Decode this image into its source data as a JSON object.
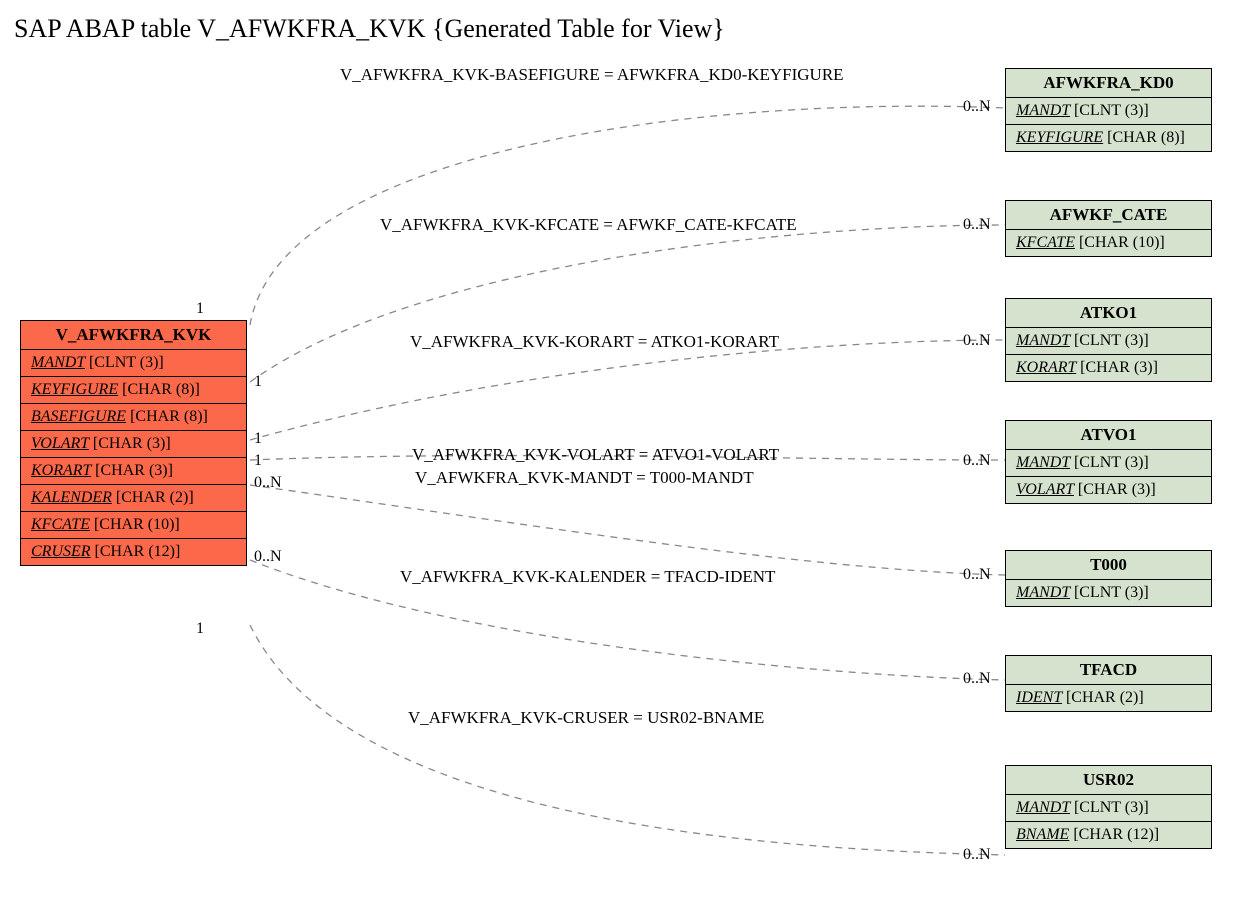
{
  "title": "SAP ABAP table V_AFWKFRA_KVK {Generated Table for View}",
  "main_entity": {
    "name": "V_AFWKFRA_KVK",
    "fields": [
      {
        "name": "MANDT",
        "type": "[CLNT (3)]"
      },
      {
        "name": "KEYFIGURE",
        "type": "[CHAR (8)]"
      },
      {
        "name": "BASEFIGURE",
        "type": "[CHAR (8)]"
      },
      {
        "name": "VOLART",
        "type": "[CHAR (3)]"
      },
      {
        "name": "KORART",
        "type": "[CHAR (3)]"
      },
      {
        "name": "KALENDER",
        "type": "[CHAR (2)]"
      },
      {
        "name": "KFCATE",
        "type": "[CHAR (10)]"
      },
      {
        "name": "CRUSER",
        "type": "[CHAR (12)]"
      }
    ]
  },
  "targets": [
    {
      "name": "AFWKFRA_KD0",
      "fields": [
        {
          "name": "MANDT",
          "type": "[CLNT (3)]"
        },
        {
          "name": "KEYFIGURE",
          "type": "[CHAR (8)]"
        }
      ]
    },
    {
      "name": "AFWKF_CATE",
      "fields": [
        {
          "name": "KFCATE",
          "type": "[CHAR (10)]"
        }
      ]
    },
    {
      "name": "ATKO1",
      "fields": [
        {
          "name": "MANDT",
          "type": "[CLNT (3)]"
        },
        {
          "name": "KORART",
          "type": "[CHAR (3)]"
        }
      ]
    },
    {
      "name": "ATVO1",
      "fields": [
        {
          "name": "MANDT",
          "type": "[CLNT (3)]"
        },
        {
          "name": "VOLART",
          "type": "[CHAR (3)]"
        }
      ]
    },
    {
      "name": "T000",
      "fields": [
        {
          "name": "MANDT",
          "type": "[CLNT (3)]"
        }
      ]
    },
    {
      "name": "TFACD",
      "fields": [
        {
          "name": "IDENT",
          "type": "[CHAR (2)]"
        }
      ]
    },
    {
      "name": "USR02",
      "fields": [
        {
          "name": "MANDT",
          "type": "[CLNT (3)]"
        },
        {
          "name": "BNAME",
          "type": "[CHAR (12)]"
        }
      ]
    }
  ],
  "relations": [
    {
      "label": "V_AFWKFRA_KVK-BASEFIGURE = AFWKFRA_KD0-KEYFIGURE",
      "left_card": "1",
      "right_card": "0..N"
    },
    {
      "label": "V_AFWKFRA_KVK-KFCATE = AFWKF_CATE-KFCATE",
      "left_card": "1",
      "right_card": "0..N"
    },
    {
      "label": "V_AFWKFRA_KVK-KORART = ATKO1-KORART",
      "left_card": "1",
      "right_card": "0..N"
    },
    {
      "label": "V_AFWKFRA_KVK-VOLART = ATVO1-VOLART",
      "left_card": "1",
      "right_card": "0..N"
    },
    {
      "label": "V_AFWKFRA_KVK-MANDT = T000-MANDT",
      "left_card": "0..N",
      "right_card": "0..N"
    },
    {
      "label": "V_AFWKFRA_KVK-KALENDER = TFACD-IDENT",
      "left_card": "0..N",
      "right_card": "0..N"
    },
    {
      "label": "V_AFWKFRA_KVK-CRUSER = USR02-BNAME",
      "left_card": "1",
      "right_card": "0..N"
    }
  ]
}
